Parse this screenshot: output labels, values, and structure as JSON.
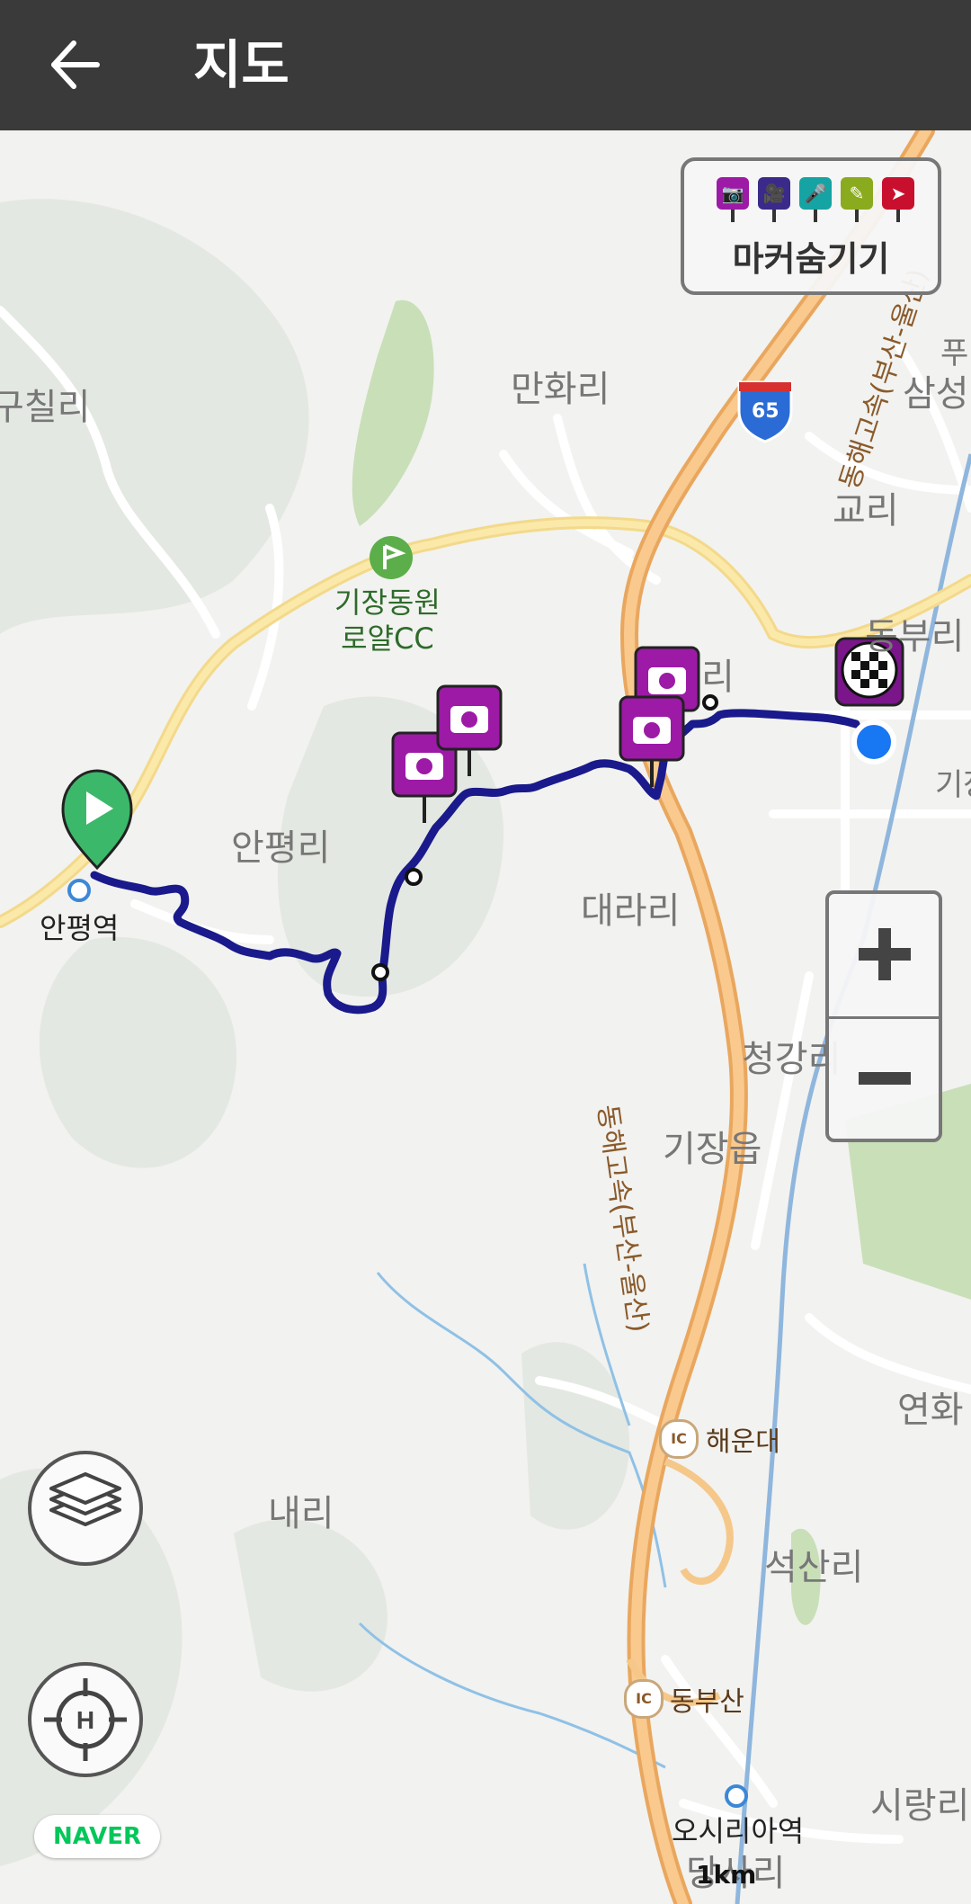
{
  "appbar": {
    "title": "지도",
    "back_icon": "arrow-left-icon"
  },
  "marker_panel": {
    "label": "마커숨기기",
    "markers": [
      {
        "name": "camera-marker-icon",
        "color": "#9c1aa6",
        "glyph": "📷"
      },
      {
        "name": "video-marker-icon",
        "color": "#3b2a8a",
        "glyph": "🎥"
      },
      {
        "name": "mic-marker-icon",
        "color": "#16a3a3",
        "glyph": "🎤"
      },
      {
        "name": "memo-marker-icon",
        "color": "#8bab1e",
        "glyph": "✎"
      },
      {
        "name": "flag-marker-icon",
        "color": "#c8102e",
        "glyph": "➤"
      }
    ]
  },
  "map_labels": {
    "guchil": "구칠리",
    "manhwa": "만화리",
    "golf": "기장동원\n로얄CC",
    "anpyeongri": "안평리",
    "anpyeong_station": "안평역",
    "gyori": "교리",
    "samseong": "삼성",
    "pu": "푸",
    "dongburi": "동부리",
    "gijang_edge": "기장",
    "ri_partial": "리",
    "darari": "대라리",
    "cheonggang": "청강리",
    "gijangeup": "기장읍",
    "highway": "동해고속(부산-울산)",
    "highway_top": "동해고속(부산-울산)",
    "route65": "65",
    "yeonhwa": "연화",
    "naeri": "내리",
    "haeundae_ic": "해운대",
    "seoksanri": "석산리",
    "dongbusan_ic": "동부산",
    "ic": "IC",
    "osiria": "오시리아역",
    "sirang": "시랑리",
    "dangsa": "당사리"
  },
  "zoom": {
    "in_icon": "plus-icon",
    "out_icon": "minus-icon"
  },
  "layers_icon": "layers-icon",
  "home_icon": "crosshair-home-icon",
  "naver": "NAVER",
  "scale": "1km",
  "colors": {
    "route": "#1a1a8c",
    "appbar": "#3a3a3a",
    "start_pin": "#3cb86a",
    "camera_pin": "#9c1aa6",
    "current_location": "#1877f2"
  }
}
